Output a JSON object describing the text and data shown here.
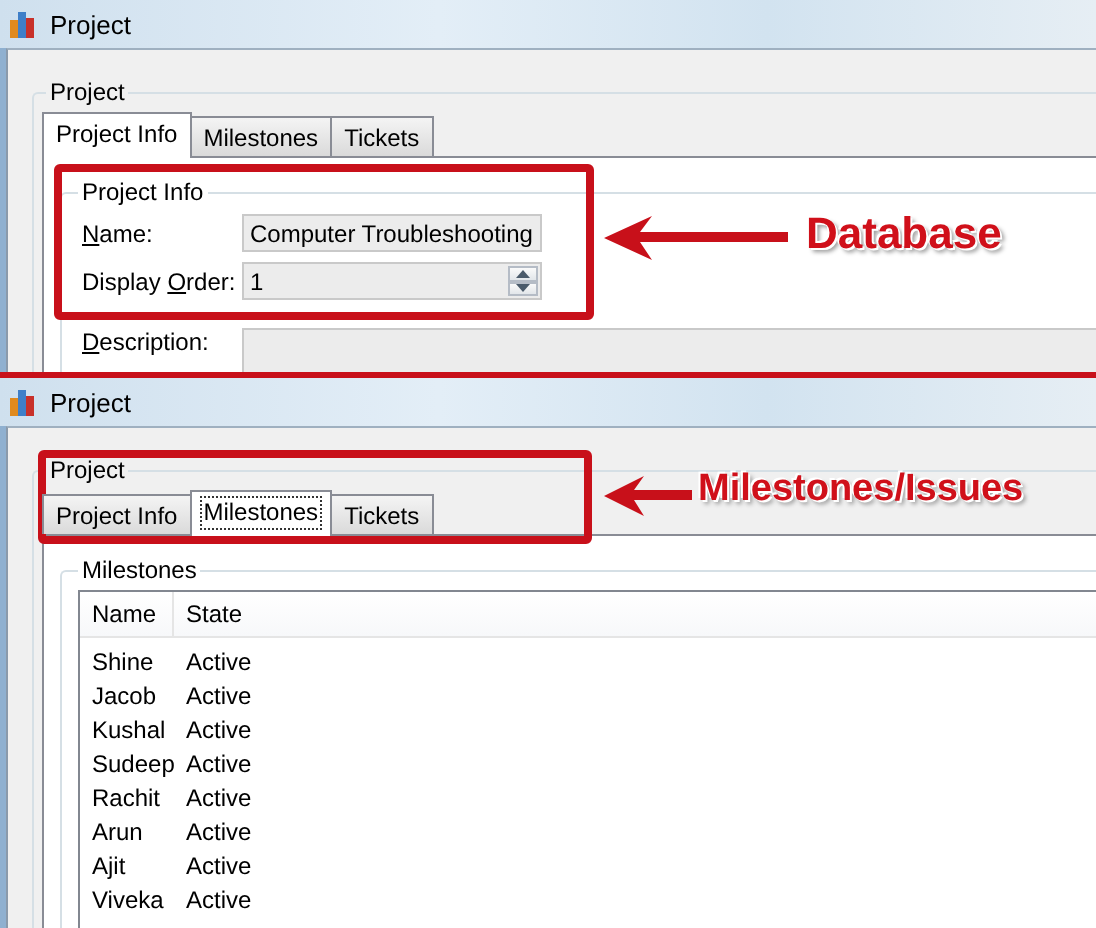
{
  "screens": [
    {
      "window": {
        "title": "Project"
      },
      "group_title": "Project",
      "tabs": [
        {
          "label": "Project Info",
          "selected": true,
          "focused": false
        },
        {
          "label": "Milestones",
          "selected": false,
          "focused": false
        },
        {
          "label": "Tickets",
          "selected": false,
          "focused": false
        }
      ],
      "content": {
        "kind": "form",
        "title": "Project Info",
        "fields": [
          {
            "kind": "text",
            "label": [
              {
                "text": "N",
                "underline": true
              },
              {
                "text": "ame:",
                "underline": false
              }
            ],
            "value": "Computer Troubleshooting"
          },
          {
            "kind": "spin",
            "label": [
              {
                "text": "Display ",
                "underline": false
              },
              {
                "text": "O",
                "underline": true
              },
              {
                "text": "rder:",
                "underline": false
              }
            ],
            "value": "1"
          },
          {
            "kind": "multiline",
            "label": [
              {
                "text": "D",
                "underline": true
              },
              {
                "text": "escription:",
                "underline": false
              }
            ]
          }
        ]
      },
      "callout": {
        "text": "Database"
      }
    },
    {
      "window": {
        "title": "Project"
      },
      "group_title": "Project",
      "tabs": [
        {
          "label": "Project Info",
          "selected": false,
          "focused": false
        },
        {
          "label": "Milestones",
          "selected": true,
          "focused": true
        },
        {
          "label": "Tickets",
          "selected": false,
          "focused": false
        }
      ],
      "content": {
        "kind": "list",
        "title": "Milestones",
        "columns": [
          "Name",
          "State"
        ],
        "rows": [
          [
            "Shine",
            "Active"
          ],
          [
            "Jacob",
            "Active"
          ],
          [
            "Kushal",
            "Active"
          ],
          [
            "Sudeep",
            "Active"
          ],
          [
            "Rachit",
            "Active"
          ],
          [
            "Arun",
            "Active"
          ],
          [
            "Ajit",
            "Active"
          ],
          [
            "Viveka",
            "Active"
          ]
        ]
      },
      "callout": {
        "text": "Milestones/Issues"
      }
    }
  ]
}
